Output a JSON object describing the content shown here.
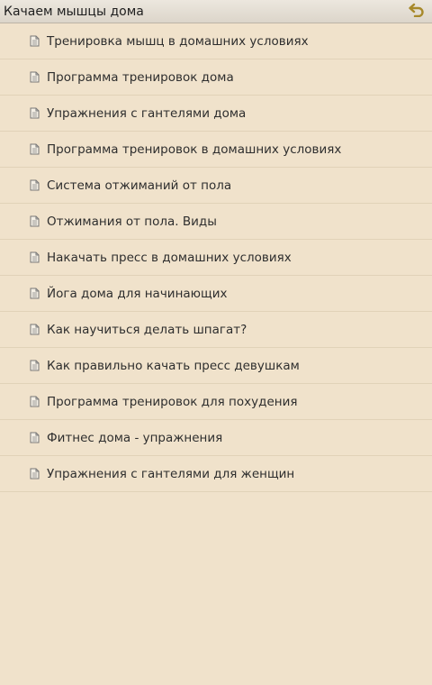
{
  "header": {
    "title": "Качаем мышцы дома",
    "back_icon": "back-arrow-icon",
    "accent_color": "#a7892a"
  },
  "list": {
    "items": [
      {
        "label": "Тренировка мышц в домашних условиях"
      },
      {
        "label": "Программа тренировок дома"
      },
      {
        "label": "Упражнения с гантелями дома"
      },
      {
        "label": "Программа тренировок в домашних условиях"
      },
      {
        "label": "Система отжиманий от пола"
      },
      {
        "label": "Отжимания от пола. Виды"
      },
      {
        "label": "Накачать пресс в домашних условиях"
      },
      {
        "label": "Йога дома для начинающих"
      },
      {
        "label": "Как научиться делать шпагат?"
      },
      {
        "label": "Как правильно качать пресс девушкам"
      },
      {
        "label": "Программа тренировок для похудения"
      },
      {
        "label": "Фитнес дома - упражнения"
      },
      {
        "label": "Упражнения с гантелями для женщин"
      }
    ]
  },
  "colors": {
    "background": "#f0e2cb",
    "divider": "#e1d2b8",
    "header": "#dcd5ca"
  }
}
